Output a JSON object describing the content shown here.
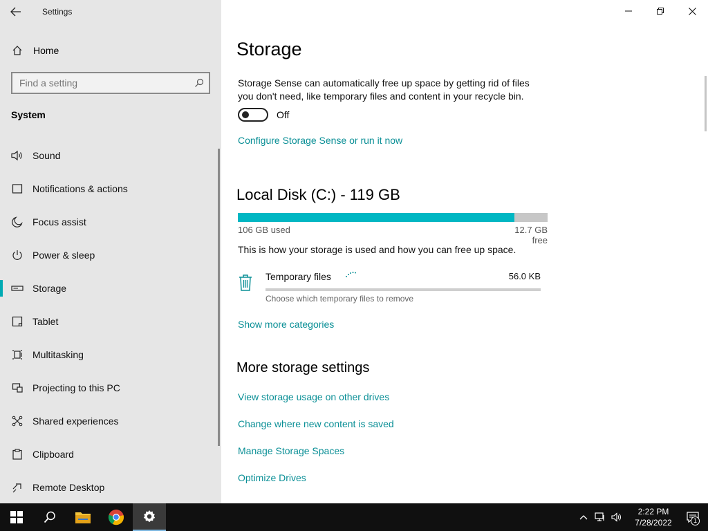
{
  "window": {
    "title": "Settings"
  },
  "sidebar": {
    "home_label": "Home",
    "search_placeholder": "Find a setting",
    "section_title": "System",
    "items": [
      {
        "label": "Sound",
        "icon": "speaker-icon"
      },
      {
        "label": "Notifications & actions",
        "icon": "notification-icon"
      },
      {
        "label": "Focus assist",
        "icon": "moon-icon"
      },
      {
        "label": "Power & sleep",
        "icon": "power-icon"
      },
      {
        "label": "Storage",
        "icon": "storage-drive-icon",
        "active": true
      },
      {
        "label": "Tablet",
        "icon": "tablet-icon"
      },
      {
        "label": "Multitasking",
        "icon": "multitasking-icon"
      },
      {
        "label": "Projecting to this PC",
        "icon": "projecting-icon"
      },
      {
        "label": "Shared experiences",
        "icon": "shared-experiences-icon"
      },
      {
        "label": "Clipboard",
        "icon": "clipboard-icon"
      },
      {
        "label": "Remote Desktop",
        "icon": "remote-desktop-icon"
      }
    ]
  },
  "main": {
    "title": "Storage",
    "storage_sense_desc": "Storage Sense can automatically free up space by getting rid of files you don't need, like temporary files and content in your recycle bin.",
    "toggle_state": "Off",
    "configure_link": "Configure Storage Sense or run it now",
    "disk": {
      "title": "Local Disk (C:) - 119 GB",
      "used_label": "106 GB used",
      "free_label": "12.7 GB free",
      "used_fraction": 0.893
    },
    "usage_text": "This is how your storage is used and how you can free up space.",
    "category": {
      "name": "Temporary files",
      "size": "56.0 KB",
      "subtitle": "Choose which temporary files to remove",
      "fill_fraction": 0.0
    },
    "show_more_label": "Show more categories",
    "more_title": "More storage settings",
    "more_links": [
      "View storage usage on other drives",
      "Change where new content is saved",
      "Manage Storage Spaces",
      "Optimize Drives"
    ]
  },
  "taskbar": {
    "time": "2:22 PM",
    "date": "7/28/2022",
    "notification_count": "1"
  },
  "colors": {
    "accent": "#00b7c3",
    "link": "#0a8f96",
    "sidebar_bg": "#e6e6e6",
    "taskbar_bg": "#101010"
  }
}
